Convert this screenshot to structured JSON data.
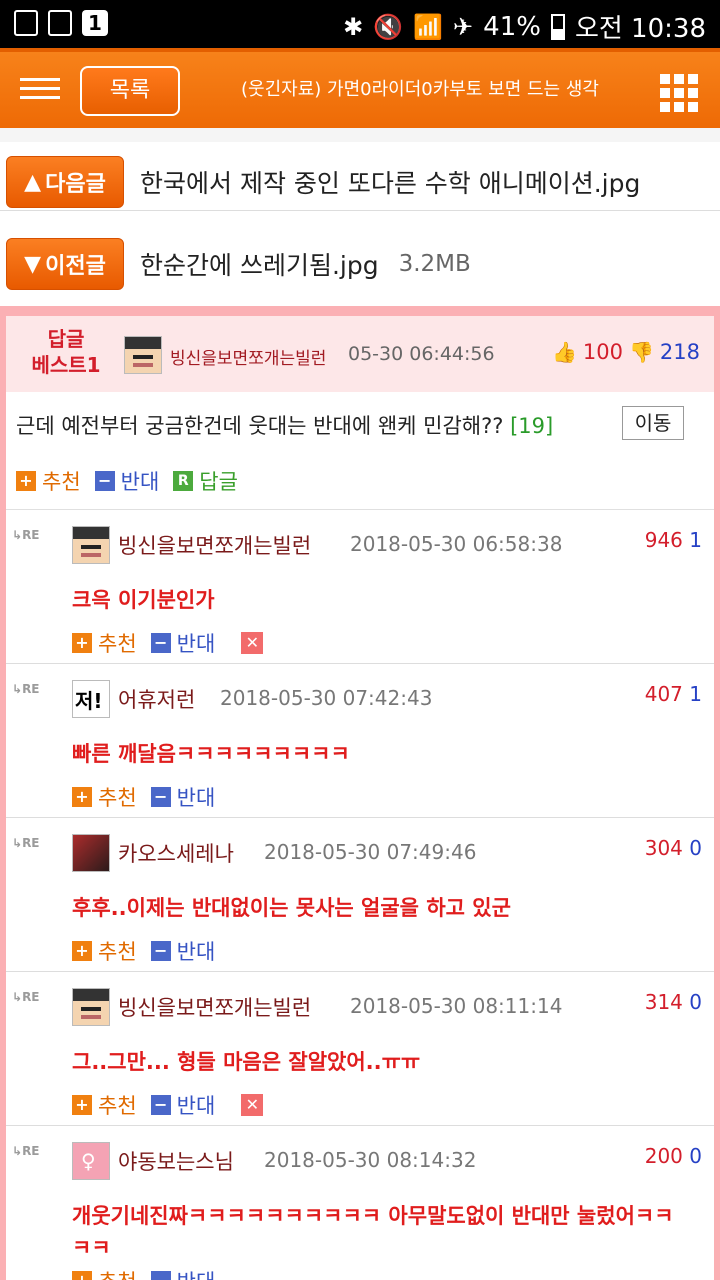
{
  "status": {
    "battery": "41%",
    "time": "오전 10:38",
    "notif_count": "1"
  },
  "header": {
    "list_button": "목록",
    "title": "(웃긴자료) 가면0라이더0카부토 보면 드는 생각"
  },
  "nav": {
    "next": {
      "label": "다음글",
      "title": "한국에서 제작 중인 또다른 수학 애니메이션.jpg"
    },
    "prev": {
      "label": "이전글",
      "title": "한순간에 쓰레기됨.jpg",
      "size": "3.2MB"
    }
  },
  "best": {
    "label_line1": "답글",
    "label_line2": "베스트1",
    "author": "빙신을보면쪼개는빌런",
    "date": "05-30 06:44:56",
    "up": "100",
    "down": "218",
    "text": "근데 예전부터 궁금한건데 웃대는 반대에 왠케 민감해??",
    "reply_count": "[19]",
    "move": "이동",
    "recommend": "추천",
    "oppose": "반대",
    "reply": "답글"
  },
  "labels": {
    "recommend": "추천",
    "oppose": "반대",
    "re": "RE"
  },
  "replies": [
    {
      "author": "빙신을보면쪼개는빌런",
      "date": "2018-05-30 06:58:38",
      "up": "946",
      "down": "1",
      "text": "크윽 이기분인가"
    },
    {
      "author": "어휴저런",
      "date": "2018-05-30 07:42:43",
      "up": "407",
      "down": "1",
      "text": "빠른 깨달음ㅋㅋㅋㅋㅋㅋㅋㅋㅋ"
    },
    {
      "author": "카오스세레나",
      "date": "2018-05-30 07:49:46",
      "up": "304",
      "down": "0",
      "text": "후후..이제는 반대없이는 못사는 얼굴을 하고 있군"
    },
    {
      "author": "빙신을보면쪼개는빌런",
      "date": "2018-05-30 08:11:14",
      "up": "314",
      "down": "0",
      "text": "그..그만... 형들 마음은 잘알았어..ㅠㅠ"
    },
    {
      "author": "야동보는스님",
      "date": "2018-05-30 08:14:32",
      "up": "200",
      "down": "0",
      "text": "개웃기네진짜ㅋㅋㅋㅋㅋㅋㅋㅋㅋㅋ 아무말도없이 반대만 눌렀어ㅋㅋㅋㅋ"
    }
  ]
}
